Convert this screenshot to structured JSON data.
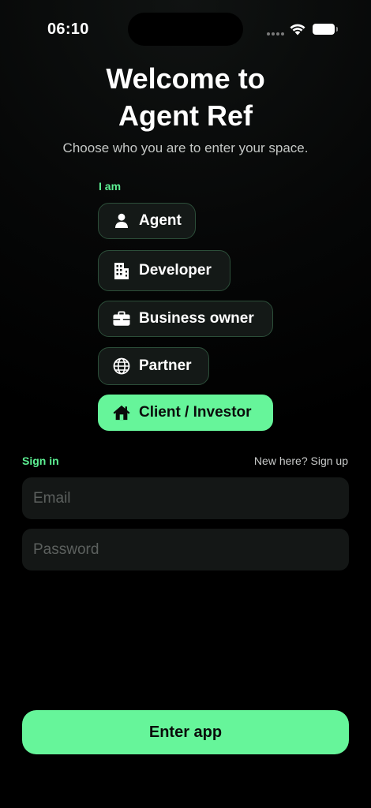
{
  "status_bar": {
    "time": "06:10"
  },
  "header": {
    "title_line1": "Welcome to",
    "title_line2": "Agent Ref",
    "subtitle": "Choose who you are to enter your space."
  },
  "roles": {
    "label": "I am",
    "selected": "Client / Investor",
    "items": [
      {
        "label": "Agent",
        "icon": "person-icon"
      },
      {
        "label": "Developer",
        "icon": "building-icon"
      },
      {
        "label": "Business owner",
        "icon": "briefcase-icon"
      },
      {
        "label": "Partner",
        "icon": "globe-icon"
      },
      {
        "label": "Client / Investor",
        "icon": "house-icon"
      }
    ]
  },
  "auth": {
    "signin_label": "Sign in",
    "signup_link": "New here? Sign up",
    "email_placeholder": "Email",
    "email_value": "",
    "password_placeholder": "Password",
    "password_value": "",
    "submit_label": "Enter app"
  },
  "colors": {
    "accent": "#66f59a",
    "accent_text": "#5df093",
    "chip_bg": "#141917",
    "chip_border": "#2c4e39",
    "field_bg": "#141716",
    "background": "#000000"
  }
}
